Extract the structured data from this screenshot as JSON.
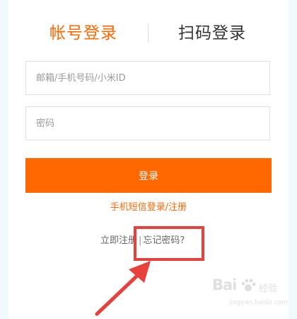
{
  "tabs": {
    "account_login": "帐号登录",
    "qr_login": "扫码登录"
  },
  "form": {
    "account_placeholder": "邮箱/手机号码/小米ID",
    "password_placeholder": "密码",
    "login_label": "登录"
  },
  "links": {
    "sms_login": "手机短信登录/注册",
    "register": "立即注册",
    "separator": "|",
    "forgot_password": "忘记密码?"
  },
  "watermark": {
    "brand": "Bai",
    "sub": "经验",
    "url": "jingyan.baidu.com"
  },
  "colors": {
    "accent": "#ff6700",
    "highlight": "#e8403a"
  }
}
